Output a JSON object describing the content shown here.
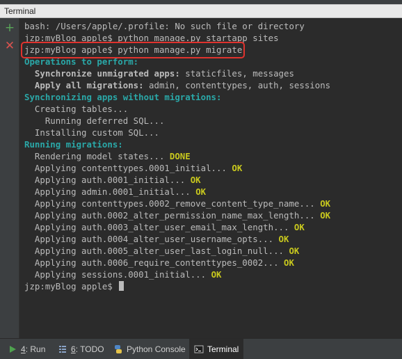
{
  "window": {
    "title": "Terminal"
  },
  "toolbar": {
    "add_glyph": "+",
    "close_glyph": "✕"
  },
  "terminal": {
    "lines": [
      [
        {
          "t": "bash: /Users/apple/.profile: No such file or directory"
        }
      ],
      [
        {
          "t": "jzp:myBlog apple$ python manage.py startapp sites"
        }
      ],
      [
        {
          "t": "jzp:myBlog apple$ python manage.py migrate"
        }
      ],
      [
        {
          "t": "Operations to perform:",
          "c": "cyan"
        }
      ],
      [
        {
          "t": "  "
        },
        {
          "t": "Synchronize unmigrated apps:",
          "c": "bold"
        },
        {
          "t": " staticfiles, messages"
        }
      ],
      [
        {
          "t": "  "
        },
        {
          "t": "Apply all migrations:",
          "c": "bold"
        },
        {
          "t": " admin, contenttypes, auth, sessions"
        }
      ],
      [
        {
          "t": "Synchronizing apps without migrations:",
          "c": "cyan"
        }
      ],
      [
        {
          "t": "  Creating tables..."
        }
      ],
      [
        {
          "t": "    Running deferred SQL..."
        }
      ],
      [
        {
          "t": "  Installing custom SQL..."
        }
      ],
      [
        {
          "t": "Running migrations:",
          "c": "cyan"
        }
      ],
      [
        {
          "t": "  Rendering model states... "
        },
        {
          "t": "DONE",
          "c": "ok"
        }
      ],
      [
        {
          "t": "  Applying contenttypes.0001_initial... "
        },
        {
          "t": "OK",
          "c": "ok"
        }
      ],
      [
        {
          "t": "  Applying auth.0001_initial... "
        },
        {
          "t": "OK",
          "c": "ok"
        }
      ],
      [
        {
          "t": "  Applying admin.0001_initial... "
        },
        {
          "t": "OK",
          "c": "ok"
        }
      ],
      [
        {
          "t": "  Applying contenttypes.0002_remove_content_type_name... "
        },
        {
          "t": "OK",
          "c": "ok"
        }
      ],
      [
        {
          "t": "  Applying auth.0002_alter_permission_name_max_length... "
        },
        {
          "t": "OK",
          "c": "ok"
        }
      ],
      [
        {
          "t": "  Applying auth.0003_alter_user_email_max_length... "
        },
        {
          "t": "OK",
          "c": "ok"
        }
      ],
      [
        {
          "t": "  Applying auth.0004_alter_user_username_opts... "
        },
        {
          "t": "OK",
          "c": "ok"
        }
      ],
      [
        {
          "t": "  Applying auth.0005_alter_user_last_login_null... "
        },
        {
          "t": "OK",
          "c": "ok"
        }
      ],
      [
        {
          "t": "  Applying auth.0006_require_contenttypes_0002... "
        },
        {
          "t": "OK",
          "c": "ok"
        }
      ],
      [
        {
          "t": "  Applying sessions.0001_initial... "
        },
        {
          "t": "OK",
          "c": "ok"
        }
      ],
      [
        {
          "t": "jzp:myBlog apple$ "
        },
        {
          "cursor": true
        }
      ]
    ],
    "highlight_color": "#e0332e",
    "colors": {
      "text": "#bbbbbb",
      "heading": "#2aa8a8",
      "ok": "#c8c81e",
      "background": "#2b2b2b"
    }
  },
  "bottom_tabs": [
    {
      "key": "4",
      "label": ": Run",
      "icon": "run-icon",
      "active": false
    },
    {
      "key": "6",
      "label": ": TODO",
      "icon": "todo-icon",
      "active": false
    },
    {
      "key": "",
      "label": "Python Console",
      "icon": "python-console-icon",
      "active": false
    },
    {
      "key": "",
      "label": "Terminal",
      "icon": "terminal-icon",
      "active": true
    }
  ]
}
